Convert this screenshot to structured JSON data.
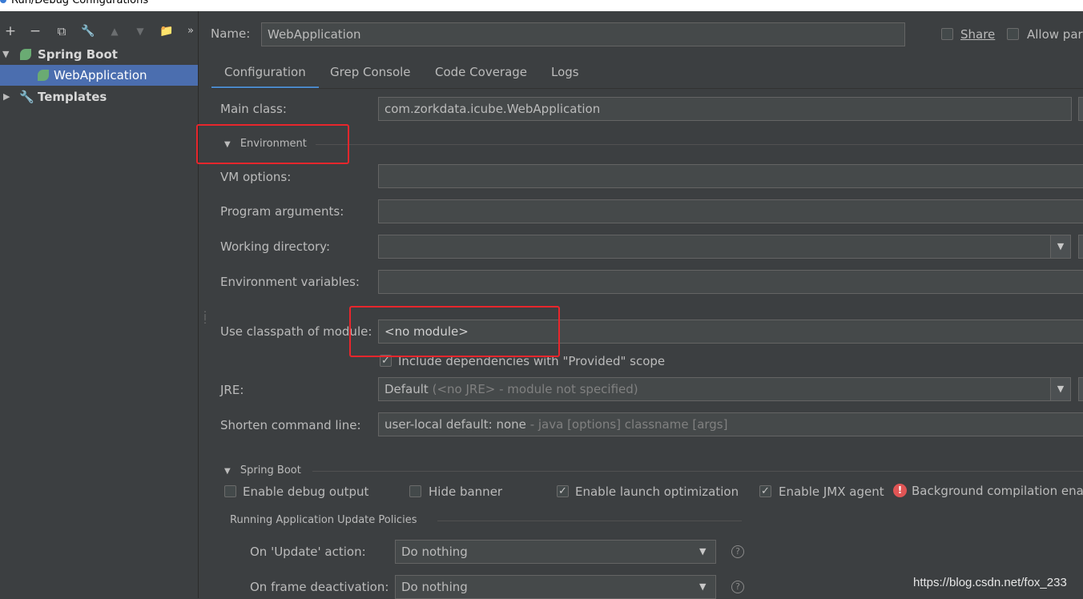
{
  "window": {
    "title": "Run/Debug Configurations"
  },
  "toolbar": {
    "add": "+",
    "remove": "−",
    "copy": "⧉",
    "edit": "🔧",
    "up": "▲",
    "down": "▼",
    "folder": "📁",
    "more": "»"
  },
  "tree": {
    "group": "Spring Boot",
    "item": "WebApplication",
    "templates": "Templates"
  },
  "header": {
    "name_label": "Name:",
    "name_value": "WebApplication",
    "share_label": "Share",
    "allow_parallel_label": "Allow parallel run"
  },
  "tabs": [
    "Configuration",
    "Grep Console",
    "Code Coverage",
    "Logs"
  ],
  "form": {
    "main_class_label": "Main class:",
    "main_class_value": "com.zorkdata.icube.WebApplication",
    "environment_section": "Environment",
    "vm_options_label": "VM options:",
    "vm_options_value": "",
    "program_args_label": "Program arguments:",
    "program_args_value": "",
    "working_dir_label": "Working directory:",
    "working_dir_value": "",
    "env_vars_label": "Environment variables:",
    "env_vars_value": "",
    "classpath_label": "Use classpath of module:",
    "classpath_value": "<no module>",
    "include_provided_label": "Include dependencies with \"Provided\" scope",
    "jre_label": "JRE:",
    "jre_value": "Default",
    "jre_hint": "(<no JRE> - module not specified)",
    "shorten_label": "Shorten command line:",
    "shorten_value": "user-local default: none",
    "shorten_hint": "- java [options] classname [args]"
  },
  "spring_boot": {
    "section": "Spring Boot",
    "debug_output": "Enable debug output",
    "hide_banner": "Hide banner",
    "launch_opt": "Enable launch optimization",
    "jmx_agent": "Enable JMX agent",
    "bg_compile": "Background compilation enabled",
    "policies_section": "Running Application Update Policies",
    "on_update_label": "On 'Update' action:",
    "on_update_value": "Do nothing",
    "on_frame_label": "On frame deactivation:",
    "on_frame_value": "Do nothing"
  },
  "watermark": "https://blog.csdn.net/fox_233",
  "colors": {
    "background": "#3c3f41",
    "selection": "#4b6eaf",
    "tab_underline": "#4a88c7",
    "annotation": "#e8262c",
    "error": "#e05555"
  }
}
